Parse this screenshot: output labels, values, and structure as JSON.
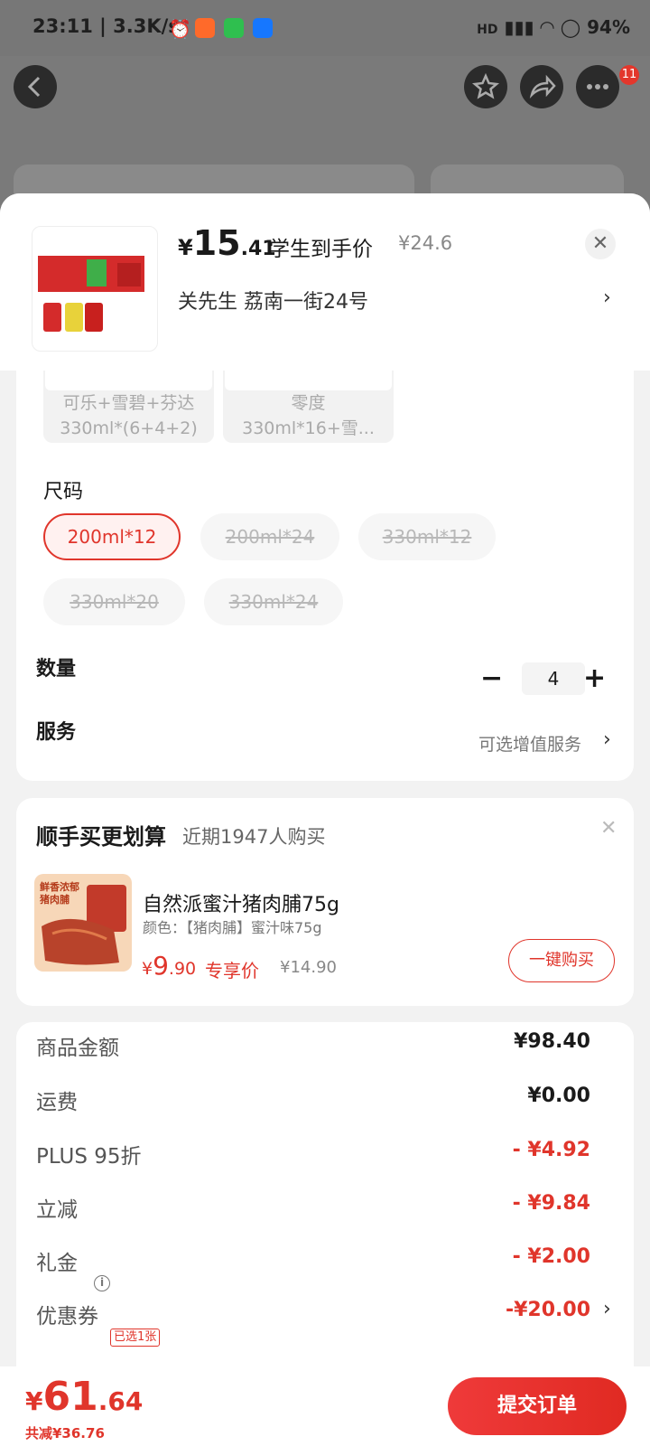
{
  "status_bar": {
    "time": "23:11",
    "net_speed": "3.3K/s",
    "battery": "94%"
  },
  "top_bar": {
    "badge_count": "11"
  },
  "product": {
    "price_currency": "¥",
    "price_int": "15",
    "price_dec": ".41",
    "price_label": "学生到手价",
    "original_price": "¥24.6",
    "address": "关先生  荔南一街24号"
  },
  "color_options": [
    {
      "line1": "可乐+雪碧+芬达",
      "line2": "330ml*(6+4+2)"
    },
    {
      "line1": "零度",
      "line2": "330ml*16+雪..."
    }
  ],
  "size": {
    "title": "尺码",
    "options": [
      {
        "label": "200ml*12",
        "selected": true
      },
      {
        "label": "200ml*24",
        "selected": false
      },
      {
        "label": "330ml*12",
        "selected": false
      },
      {
        "label": "330ml*20",
        "selected": false
      },
      {
        "label": "330ml*24",
        "selected": false
      }
    ]
  },
  "quantity": {
    "title": "数量",
    "value": "4",
    "minus": "−",
    "plus": "+"
  },
  "service": {
    "title": "服务",
    "value": "可选增值服务"
  },
  "recommend": {
    "title": "顺手买更划算",
    "subtitle": "近期1947人购买",
    "item": {
      "name": "自然派蜜汁猪肉脯75g",
      "spec": "颜色：【猪肉脯】蜜汁味75g",
      "price_currency": "¥",
      "price_int": "9",
      "price_dec": ".90",
      "tag": "专享价",
      "original_price": "¥14.90",
      "buy_label": "一键购买",
      "img_text_1": "鲜香浓郁",
      "img_text_2": "猪肉脯"
    }
  },
  "summary": [
    {
      "label": "商品金额",
      "value": "¥98.40",
      "red": false
    },
    {
      "label": "运费",
      "value": "¥0.00",
      "red": false
    },
    {
      "label": "PLUS 95折",
      "value": "- ¥4.92",
      "red": true
    },
    {
      "label": "立减",
      "value": "- ¥9.84",
      "red": true
    },
    {
      "label": "礼金",
      "value": "- ¥2.00",
      "red": true
    },
    {
      "label": "优惠券",
      "value": "-¥20.00",
      "red": true
    }
  ],
  "coupon_tag": "已选1张",
  "footer": {
    "total_currency": "¥",
    "total_int": "61",
    "total_dec": ".64",
    "saved": "共减¥36.76",
    "submit_label": "提交订单"
  },
  "colors": {
    "accent": "#e0352b",
    "overlay": "#7a7a7a"
  }
}
